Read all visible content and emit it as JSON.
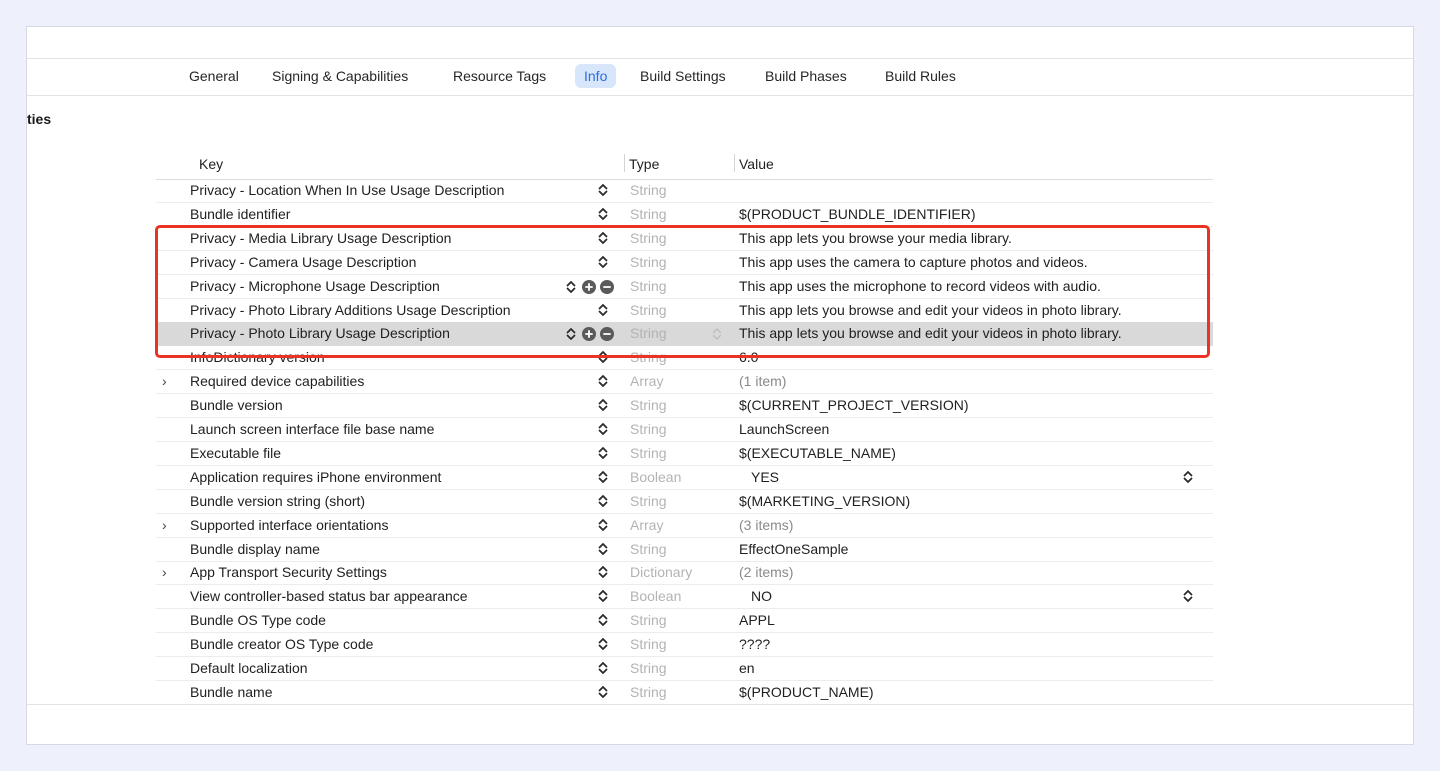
{
  "tabs": [
    {
      "label": "General",
      "active": false
    },
    {
      "label": "Signing & Capabilities",
      "active": false
    },
    {
      "label": "Resource Tags",
      "active": false
    },
    {
      "label": "Info",
      "active": true
    },
    {
      "label": "Build Settings",
      "active": false
    },
    {
      "label": "Build Phases",
      "active": false
    },
    {
      "label": "Build Rules",
      "active": false
    }
  ],
  "section_title": "ties",
  "columns": {
    "key": "Key",
    "type": "Type",
    "value": "Value"
  },
  "rows": [
    {
      "key": "Privacy - Location When In Use Usage Description",
      "type": "String",
      "value": ""
    },
    {
      "key": "Bundle identifier",
      "type": "String",
      "value": "$(PRODUCT_BUNDLE_IDENTIFIER)"
    },
    {
      "key": "Privacy - Media Library Usage Description",
      "type": "String",
      "value": "This app lets you browse your media library."
    },
    {
      "key": "Privacy - Camera Usage Description",
      "type": "String",
      "value": "This app uses the camera to capture photos and videos."
    },
    {
      "key": "Privacy - Microphone Usage Description",
      "type": "String",
      "value": "This app uses the microphone to record videos with audio."
    },
    {
      "key": "Privacy - Photo Library Additions Usage Description",
      "type": "String",
      "value": "This app lets you browse and edit your videos in photo library."
    },
    {
      "key": "Privacy - Photo Library Usage Description",
      "type": "String",
      "value": "This app lets you browse and edit your videos in photo library."
    },
    {
      "key": "InfoDictionary version",
      "type": "String",
      "value": "6.0"
    },
    {
      "key": "Required device capabilities",
      "type": "Array",
      "value": "(1 item)"
    },
    {
      "key": "Bundle version",
      "type": "String",
      "value": "$(CURRENT_PROJECT_VERSION)"
    },
    {
      "key": "Launch screen interface file base name",
      "type": "String",
      "value": "LaunchScreen"
    },
    {
      "key": "Executable file",
      "type": "String",
      "value": "$(EXECUTABLE_NAME)"
    },
    {
      "key": "Application requires iPhone environment",
      "type": "Boolean",
      "value": "YES"
    },
    {
      "key": "Bundle version string (short)",
      "type": "String",
      "value": "$(MARKETING_VERSION)"
    },
    {
      "key": "Supported interface orientations",
      "type": "Array",
      "value": "(3 items)"
    },
    {
      "key": "Bundle display name",
      "type": "String",
      "value": "EffectOneSample"
    },
    {
      "key": "App Transport Security Settings",
      "type": "Dictionary",
      "value": "(2 items)"
    },
    {
      "key": "View controller-based status bar appearance",
      "type": "Boolean",
      "value": "NO"
    },
    {
      "key": "Bundle OS Type code",
      "type": "String",
      "value": "APPL"
    },
    {
      "key": "Bundle creator OS Type code",
      "type": "String",
      "value": "????"
    },
    {
      "key": "Default localization",
      "type": "String",
      "value": "en"
    },
    {
      "key": "Bundle name",
      "type": "String",
      "value": "$(PRODUCT_NAME)"
    }
  ],
  "selected_row": "Privacy - Photo Library Usage Description",
  "highlight_color": "#ea3323",
  "accent": "#2b6fe0"
}
